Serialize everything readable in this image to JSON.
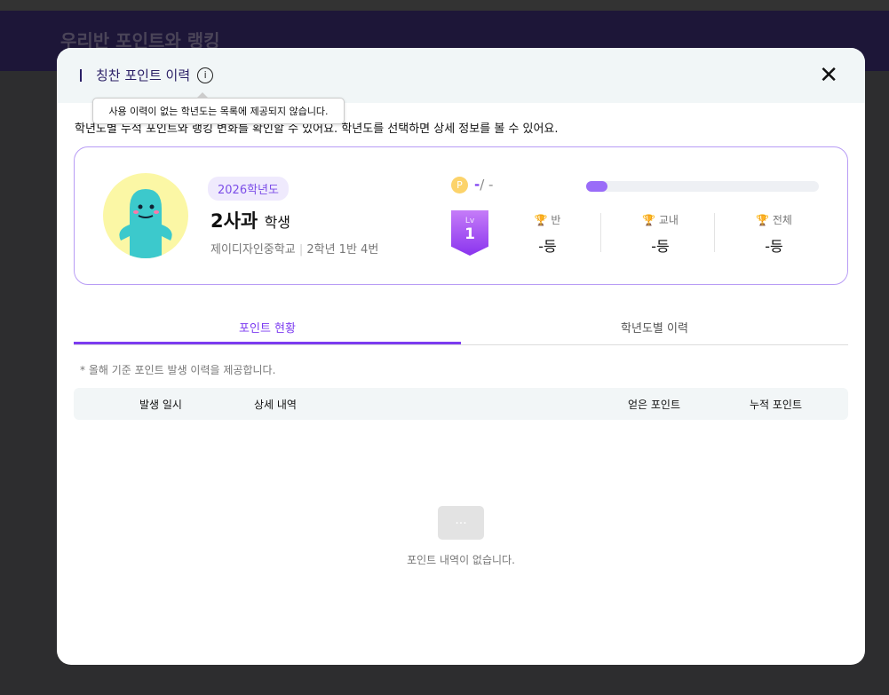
{
  "background": {
    "title": "우리반 포인트와 랭킹"
  },
  "modal": {
    "title": "칭찬 포인트 이력",
    "close_icon": "close-icon",
    "tooltip": "사용 이력이 없는 학년도는 목록에 제공되지 않습니다.",
    "description": "학년도별 누적 포인트와 랭킹 변화를 확인할 수 있어요. 학년도를 선택하면 상세 정보를 볼 수 있어요."
  },
  "profile": {
    "year": "2026학년도",
    "name": "2사과",
    "role": "학생",
    "school": "제이디자인중학교",
    "class": "2학년 1반 4번",
    "coin_label": "P",
    "points_current": "-",
    "points_total": "/ -",
    "progress_percent": 9,
    "level_label": "Lv",
    "level": "1",
    "ranks": [
      {
        "label": "반",
        "value": "-등"
      },
      {
        "label": "교내",
        "value": "-등"
      },
      {
        "label": "전체",
        "value": "-등"
      }
    ]
  },
  "tabs": [
    {
      "label": "포인트 현황",
      "active": true
    },
    {
      "label": "학년도별 이력",
      "active": false
    }
  ],
  "note": "* 올해 기준 포인트 발생 이력을 제공합니다.",
  "table": {
    "columns": [
      "발생 일시",
      "상세 내역",
      "얻은 포인트",
      "누적 포인트"
    ]
  },
  "empty": {
    "icon": "···",
    "text": "포인트 내역이 없습니다."
  },
  "colors": {
    "accent": "#7c3cf0",
    "title": "#2a1f66"
  }
}
